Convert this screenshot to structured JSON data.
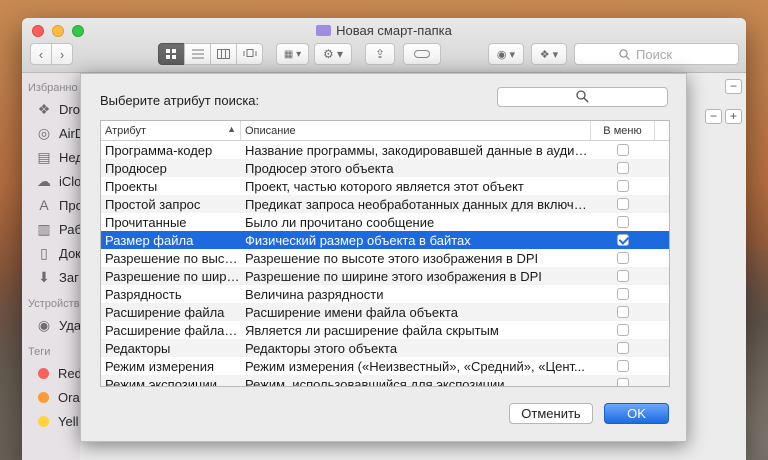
{
  "window": {
    "title": "Новая смарт-папка",
    "search_placeholder": "Поиск"
  },
  "sidebar": {
    "favorites_header": "Избранно",
    "favorites": [
      {
        "label": "Dro",
        "icon": "dropbox-icon"
      },
      {
        "label": "AirD",
        "icon": "airdrop-icon"
      },
      {
        "label": "Нед",
        "icon": "recents-icon"
      },
      {
        "label": "iClo",
        "icon": "icloud-icon"
      },
      {
        "label": "Про",
        "icon": "applications-icon"
      },
      {
        "label": "Раб",
        "icon": "desktop-icon"
      },
      {
        "label": "Док",
        "icon": "documents-icon"
      },
      {
        "label": "Заг",
        "icon": "downloads-icon"
      }
    ],
    "devices_header": "Устройств",
    "devices": [
      {
        "label": "Уда",
        "icon": "remote-disc-icon"
      }
    ],
    "tags_header": "Теги",
    "tags": [
      {
        "label": "Red",
        "color": "#fc605c"
      },
      {
        "label": "Ora",
        "color": "#fd9a33"
      },
      {
        "label": "Yell",
        "color": "#fdd43c"
      }
    ]
  },
  "dialog": {
    "prompt": "Выберите атрибут поиска:",
    "columns": {
      "attribute": "Атрибут",
      "description": "Описание",
      "in_menu": "В меню"
    },
    "rows": [
      {
        "attribute": "Программа-кодер",
        "description": "Название программы, закодировавшей данные в аудио...",
        "in_menu": false
      },
      {
        "attribute": "Продюсер",
        "description": "Продюсер этого объекта",
        "in_menu": false
      },
      {
        "attribute": "Проекты",
        "description": "Проект, частью которого является этот объект",
        "in_menu": false
      },
      {
        "attribute": "Простой запрос",
        "description": "Предикат запроса необработанных данных для включе...",
        "in_menu": false
      },
      {
        "attribute": "Прочитанные",
        "description": "Было ли прочитано сообщение",
        "in_menu": false
      },
      {
        "attribute": "Размер файла",
        "description": "Физический размер объекта в байтах",
        "in_menu": true,
        "selected": true
      },
      {
        "attribute": "Разрешение по высо...",
        "description": "Разрешение по высоте этого изображения в DPI",
        "in_menu": false
      },
      {
        "attribute": "Разрешение по шири...",
        "description": "Разрешение по ширине этого изображения в DPI",
        "in_menu": false
      },
      {
        "attribute": "Разрядность",
        "description": "Величина разрядности",
        "in_menu": false
      },
      {
        "attribute": "Расширение файла",
        "description": "Расширение имени файла объекта",
        "in_menu": false
      },
      {
        "attribute": "Расширение файла с...",
        "description": "Является ли расширение файла скрытым",
        "in_menu": false
      },
      {
        "attribute": "Редакторы",
        "description": "Редакторы этого объекта",
        "in_menu": false
      },
      {
        "attribute": "Режим измерения",
        "description": "Режим измерения («Неизвестный», «Средний», «Цент...",
        "in_menu": false
      },
      {
        "attribute": "Режим экспозиции",
        "description": "Режим, использовавшийся для экспозиции",
        "in_menu": false
      }
    ],
    "cancel_label": "Отменить",
    "ok_label": "OK"
  },
  "colors": {
    "accent": "#1d6ae0",
    "selection": "#1d6ae0"
  }
}
